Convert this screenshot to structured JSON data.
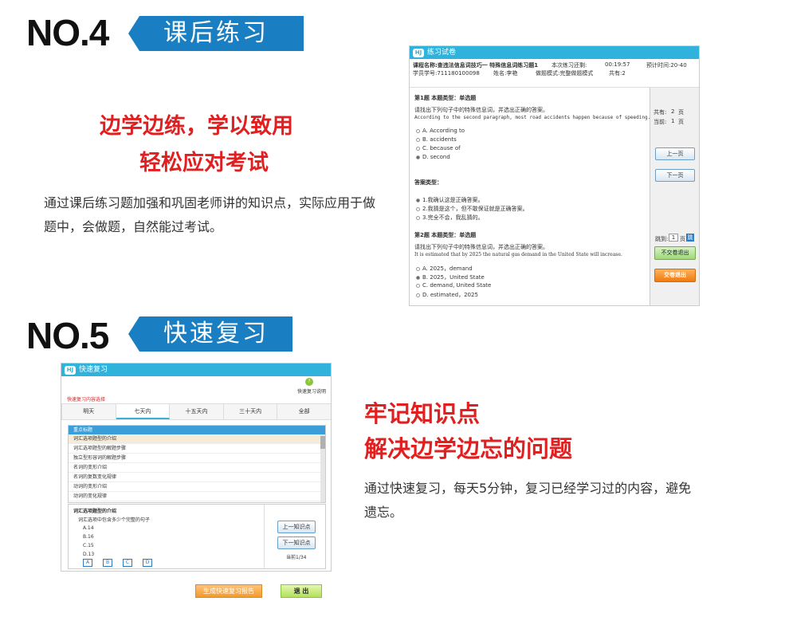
{
  "section4": {
    "no": "NO.4",
    "tag": "课后练习",
    "headline1": "边学边练，学以致用",
    "headline2": "轻松应对考试",
    "description": "通过课后练习题加强和巩固老师讲的知识点，实际应用于做题中，会做题，自然能过考试。"
  },
  "exam": {
    "title": "练习试卷",
    "course_label": "课程名称:查违法信息词技巧一 特殊信息词练习题1",
    "time_label": "本次练习还剩:",
    "time_value": "00:19:57",
    "estimate": "预计时间:20-40",
    "student": "学员学号:711180100098",
    "name": "姓名:李艳",
    "mode": "做题模式:完整做题模式",
    "total": "共有:2",
    "q1_type": "第1题 本题类型：单选题",
    "q1_prompt": "请找出下列句子中的特殊信息词，并选出正确的答案。",
    "q1_sentence": "According to the second paragraph, most road accidents happen because of speeding.",
    "q1_options": [
      "A. According to",
      "B. accidents",
      "C. because of",
      "D. second"
    ],
    "answer_type": "答案类型：",
    "answer_options": [
      "1.我确认这是正确答案。",
      "2.我猜是这个，但不敢保证就是正确答案。",
      "3.完全不会，我乱猜的。"
    ],
    "q2_type": "第2题 本题类型：单选题",
    "q2_prompt": "请找出下列句子中的特殊信息词，并选出正确的答案。",
    "q2_sentence": "It is estimated that by 2025 the natural gas demand in the United State will increase.",
    "q2_options": [
      "A. 2025，demand",
      "B. 2025，United State",
      "C. demand, United State",
      "D. estimated，2025"
    ],
    "pages_total_label": "共有:",
    "pages_total": "2",
    "pages_unit": "页",
    "current_label": "当前:",
    "current": "1",
    "prev": "上一页",
    "next": "下一页",
    "jump_label": "跳到:",
    "jump_value": "1",
    "jump_unit": "页",
    "jump_go": "跳",
    "exit_no_submit": "不交卷退出",
    "submit_exit": "交卷退出"
  },
  "section5": {
    "no": "NO.5",
    "tag": "快速复习",
    "headline1": "牢记知识点",
    "headline2": "解决边学边忘的问题",
    "description": "通过快速复习，每天5分钟，复习已经学习过的内容，避免遗忘。"
  },
  "review": {
    "title": "快速复习",
    "help": "快速复习说明",
    "choose": "快速复习内容选择",
    "tabs": [
      "明天",
      "七天内",
      "十五天内",
      "三十天内",
      "全部"
    ],
    "list_header": "重点标题",
    "list": [
      "词汇选项题型的介绍",
      "词汇选项题型的解题步骤",
      "独立型形容词的解题步骤",
      "名词的变形介绍",
      "名词的复数变化规律",
      "动词的变形介绍",
      "动词的变化规律"
    ],
    "detail_title": "词汇选项题型的介绍",
    "detail_question": "词汇选项中包含多少个完整的句子",
    "detail_options": [
      "A.14",
      "B.16",
      "C.15",
      "D.13"
    ],
    "answer_boxes": [
      "A",
      "B",
      "C",
      "D"
    ],
    "prev": "上一知识点",
    "next": "下一知识点",
    "counter": "当前1/34",
    "report": "生成快速复习报告",
    "exit": "退 出"
  }
}
